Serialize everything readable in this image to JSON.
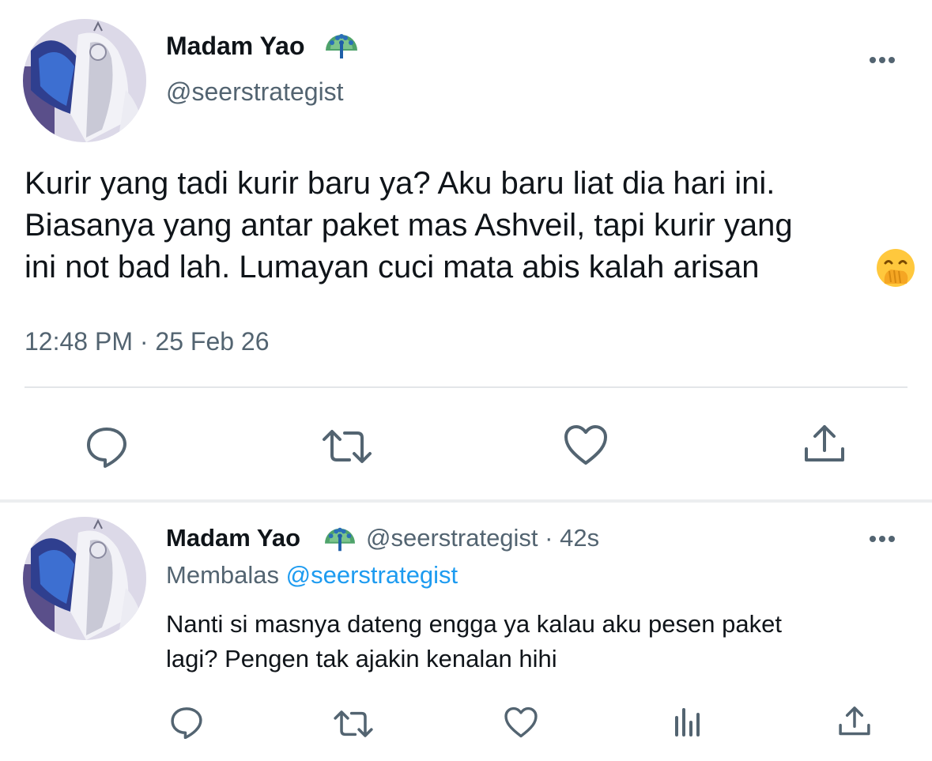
{
  "main_tweet": {
    "author": {
      "display_name": "Madam Yao",
      "badge_icon": "peacock-emoji",
      "handle": "@seerstrategist"
    },
    "text_lines": [
      "Kurir yang tadi kurir baru ya? Aku baru liat dia hari ini.",
      "Biasanya yang antar paket mas Ashveil, tapi kurir yang",
      "ini not bad lah. Lumayan cuci mata abis kalah arisan"
    ],
    "trailing_emoji": "face-with-hand-over-mouth-emoji",
    "timestamp": "12:48 PM · 25 Feb 26",
    "actions": [
      "reply-icon",
      "retweet-icon",
      "like-icon",
      "share-icon"
    ]
  },
  "reply_tweet": {
    "author": {
      "display_name": "Madam Yao",
      "badge_icon": "peacock-emoji",
      "handle_time": "@seerstrategist · 42s"
    },
    "replying_prefix": "Membalas",
    "replying_to": "@seerstrategist",
    "text_lines": [
      "Nanti si masnya dateng engga ya kalau aku pesen paket",
      "lagi? Pengen tak ajakin kenalan hihi"
    ],
    "actions": [
      "reply-icon",
      "retweet-icon",
      "like-icon",
      "analytics-icon",
      "share-icon"
    ]
  },
  "colors": {
    "text_primary": "#0f1419",
    "text_secondary": "#536471",
    "link": "#1d9bf0",
    "icon": "#536471",
    "divider": "#e3e6e9"
  }
}
